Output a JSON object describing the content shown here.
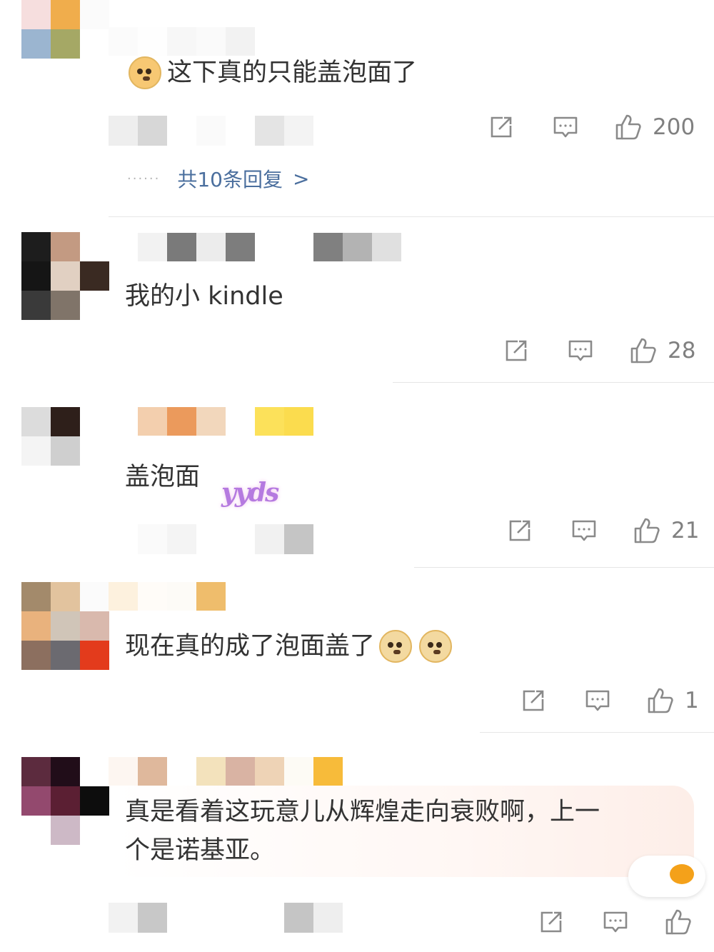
{
  "comments": [
    {
      "text": "这下真的只能盖泡面了",
      "emoji_before": "crying-doge-emoji",
      "repost_icon": "repost-icon",
      "reply_icon": "comment-icon",
      "like_icon": "thumb-up-icon",
      "likes": "200",
      "replies_dots": "······",
      "replies_link": "共10条回复",
      "replies_arrow": ">"
    },
    {
      "text": "我的小 kindle",
      "likes": "28"
    },
    {
      "text": "盖泡面",
      "sticker": "yyds",
      "likes": "21"
    },
    {
      "text": "现在真的成了泡面盖了",
      "emoji_after": [
        "doge-emoji",
        "doge-emoji"
      ],
      "likes": "1"
    },
    {
      "text_line1": "真是看着这玩意儿从辉煌走向衰败啊，上一",
      "text_line2": "个是诺基亚。",
      "likes": ""
    }
  ],
  "colors": {
    "text": "#333333",
    "meta": "#808080",
    "link": "#4b6f9e",
    "divider": "#e6e6e6",
    "icon": "#8a8a8a"
  }
}
